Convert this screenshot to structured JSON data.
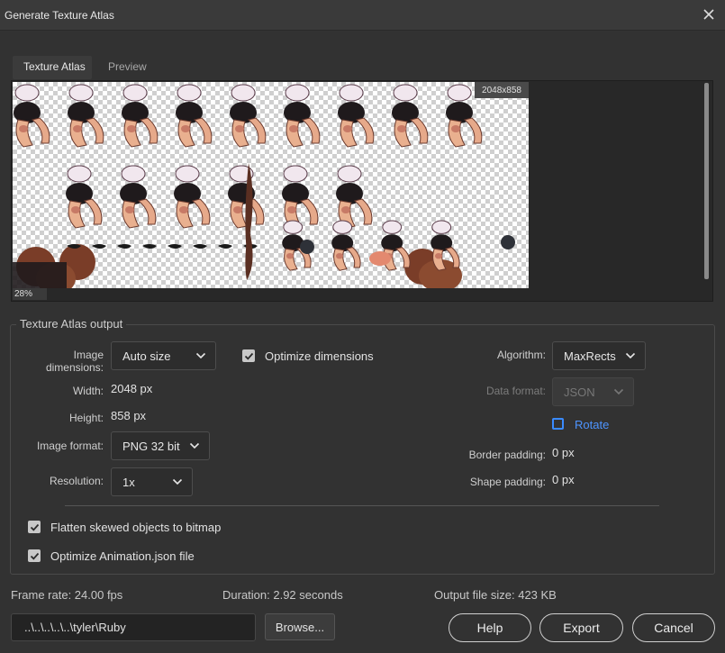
{
  "window": {
    "title": "Generate Texture Atlas"
  },
  "tabs": [
    {
      "label": "Texture Atlas",
      "active": true
    },
    {
      "label": "Preview",
      "active": false
    }
  ],
  "preview": {
    "size_badge": "2048x858",
    "zoom": "28%"
  },
  "group": {
    "title": "Texture Atlas output"
  },
  "fields": {
    "image_dimensions": {
      "label": "Image dimensions:",
      "value": "Auto size"
    },
    "optimize_dimensions": {
      "label": "Optimize dimensions",
      "checked": true
    },
    "width": {
      "label": "Width:",
      "value": "2048",
      "unit": "px"
    },
    "height": {
      "label": "Height:",
      "value": "858",
      "unit": "px"
    },
    "image_format": {
      "label": "Image format:",
      "value": "PNG 32 bit"
    },
    "resolution": {
      "label": "Resolution:",
      "value": "1x"
    },
    "algorithm": {
      "label": "Algorithm:",
      "value": "MaxRects"
    },
    "data_format": {
      "label": "Data format:",
      "value": "JSON",
      "disabled": true
    },
    "rotate": {
      "label": "Rotate",
      "checked": false
    },
    "border_padding": {
      "label": "Border padding:",
      "value": "0",
      "unit": "px"
    },
    "shape_padding": {
      "label": "Shape padding:",
      "value": "0",
      "unit": "px"
    },
    "flatten": {
      "label": "Flatten skewed objects to bitmap",
      "checked": true
    },
    "optimize_json": {
      "label": "Optimize Animation.json file",
      "checked": true
    }
  },
  "status": {
    "frame_rate": "Frame rate: 24.00 fps",
    "duration": "Duration: 2.92 seconds",
    "output_size": "Output file size: 423 KB"
  },
  "footer": {
    "path": "..\\..\\..\\..\\..\\tyler\\Ruby",
    "browse": "Browse...",
    "help": "Help",
    "export": "Export",
    "cancel": "Cancel"
  },
  "colors": {
    "accent": "#3a8bff",
    "background": "#323232"
  }
}
